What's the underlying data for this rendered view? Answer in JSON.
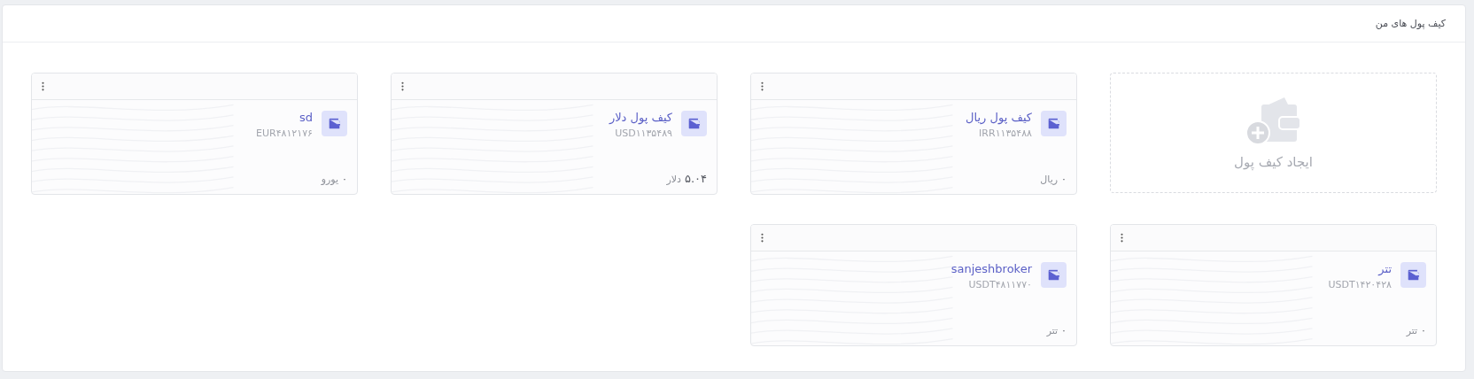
{
  "panel": {
    "title": "کیف پول های من"
  },
  "create_card": {
    "label": "ایجاد کیف پول"
  },
  "wallets": [
    {
      "name": "کیف پول ریال",
      "code": "IRR۱۱۳۵۴۸۸",
      "amount": "۰",
      "unit": "ریال"
    },
    {
      "name": "کیف پول دلار",
      "code": "USD۱۱۳۵۴۸۹",
      "amount": "۵.۰۴",
      "unit": "دلار"
    },
    {
      "name": "sd",
      "code": "EUR۴۸۱۲۱۷۶",
      "amount": "۰",
      "unit": "یورو"
    },
    {
      "name": "تتر",
      "code": "USDT۱۴۲۰۴۲۸",
      "amount": "۰",
      "unit": "تتر"
    },
    {
      "name": "sanjeshbroker",
      "code": "USDT۴۸۱۱۷۷۰",
      "amount": "۰",
      "unit": "تتر"
    }
  ]
}
